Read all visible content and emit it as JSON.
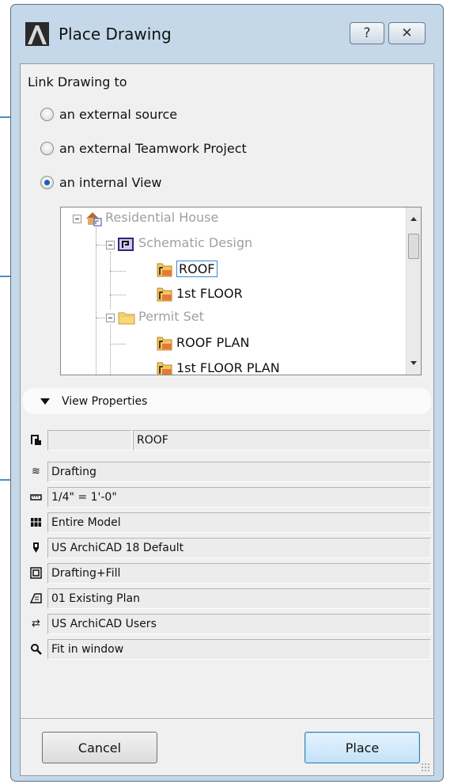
{
  "dialog": {
    "title": "Place Drawing",
    "help_label": "?",
    "close_label": "✕"
  },
  "link": {
    "heading": "Link  Drawing to",
    "options": [
      {
        "label": "an external source",
        "selected": false
      },
      {
        "label": "an external Teamwork Project",
        "selected": false
      },
      {
        "label": "an internal View",
        "selected": true
      }
    ]
  },
  "tree": {
    "items": [
      {
        "label": "Residential House",
        "state": "disabled"
      },
      {
        "label": "Schematic Design",
        "state": "disabled"
      },
      {
        "label": "ROOF",
        "state": "selected"
      },
      {
        "label": "1st FLOOR",
        "state": "normal"
      },
      {
        "label": "Permit Set",
        "state": "disabled"
      },
      {
        "label": "ROOF PLAN",
        "state": "normal"
      },
      {
        "label": "1st FLOOR PLAN",
        "state": "normal"
      }
    ]
  },
  "view_properties": {
    "heading": "View Properties",
    "view_id": "",
    "view_name": "ROOF",
    "rows": [
      {
        "icon": "layer-combination-icon",
        "value": "Drafting"
      },
      {
        "icon": "scale-icon",
        "value": "1/4\"   =    1'-0\""
      },
      {
        "icon": "structure-display-icon",
        "value": "Entire Model"
      },
      {
        "icon": "pen-set-icon",
        "value": "US ArchiCAD 18 Default"
      },
      {
        "icon": "model-view-icon",
        "value": "Drafting+Fill"
      },
      {
        "icon": "renovation-filter-icon",
        "value": "01 Existing Plan"
      },
      {
        "icon": "dimension-style-icon",
        "value": "US ArchiCAD Users"
      },
      {
        "icon": "zoom-icon",
        "value": "Fit in window"
      }
    ]
  },
  "buttons": {
    "cancel": "Cancel",
    "place": "Place"
  },
  "colors": {
    "window_frame": "#c4d8ea",
    "accent_blue": "#4a8fcf",
    "place_button": "#d6eafa"
  }
}
